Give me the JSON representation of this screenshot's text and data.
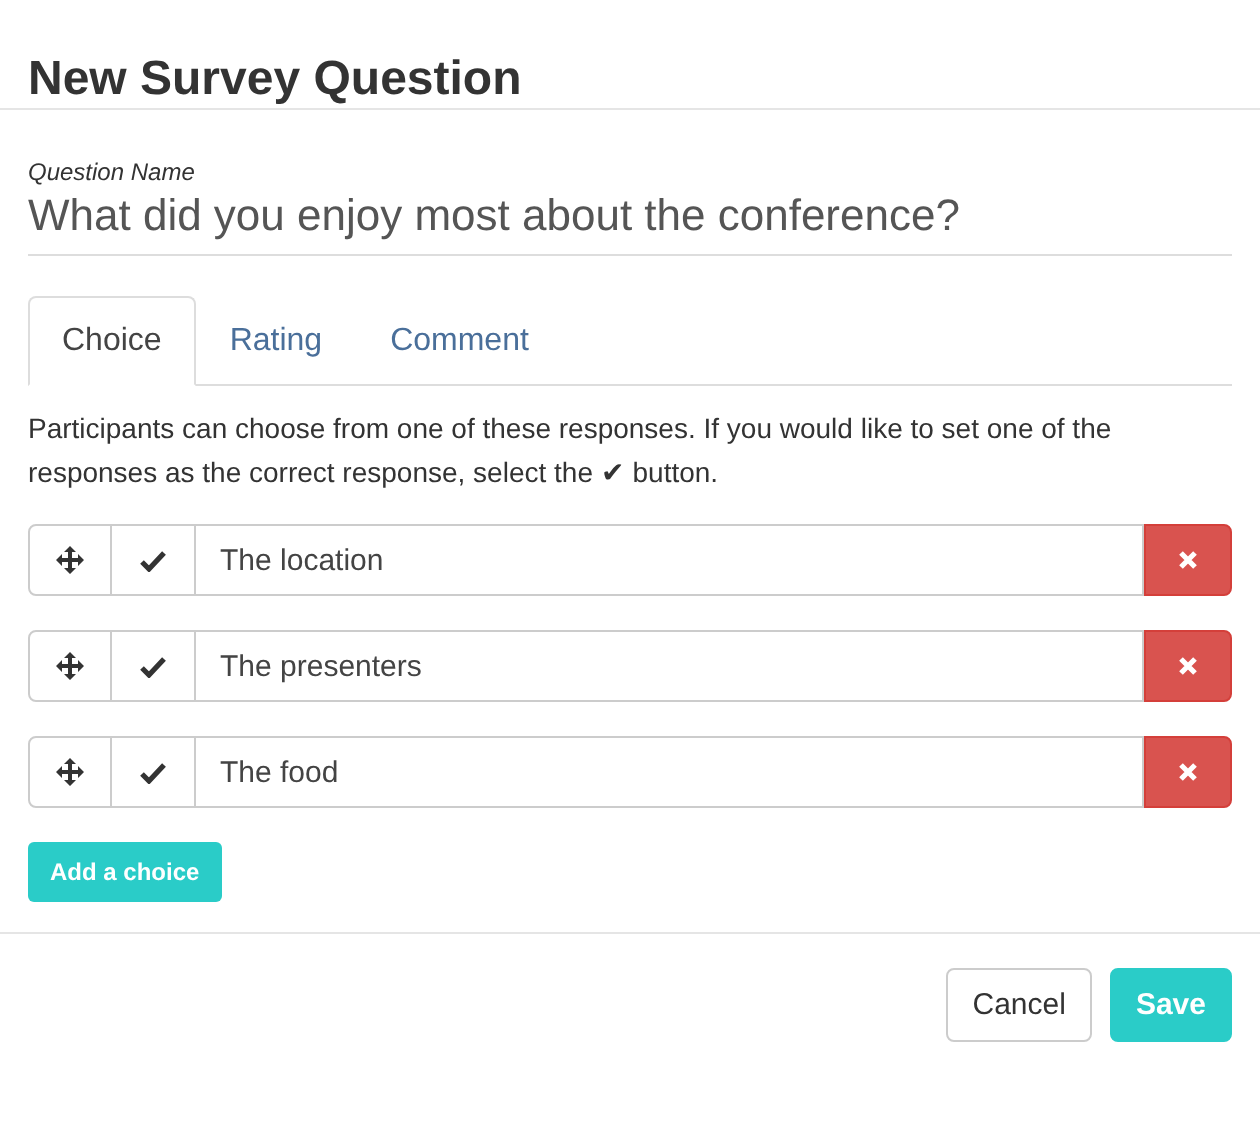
{
  "dialog": {
    "title": "New Survey Question"
  },
  "question": {
    "label": "Question Name",
    "value": "What did you enjoy most about the conference?"
  },
  "tabs": [
    {
      "label": "Choice",
      "selected": true
    },
    {
      "label": "Rating",
      "selected": false
    },
    {
      "label": "Comment",
      "selected": false
    }
  ],
  "help_text": "Participants can choose from one of these responses. If you would like to set one of the responses as the correct response, select the ✔ button.",
  "choices": [
    {
      "value": "The location"
    },
    {
      "value": "The presenters"
    },
    {
      "value": "The food"
    }
  ],
  "add_button": "Add a choice",
  "footer_buttons": [
    {
      "label": "Cancel",
      "kind": "default"
    },
    {
      "label": "Save",
      "kind": "primary"
    }
  ]
}
